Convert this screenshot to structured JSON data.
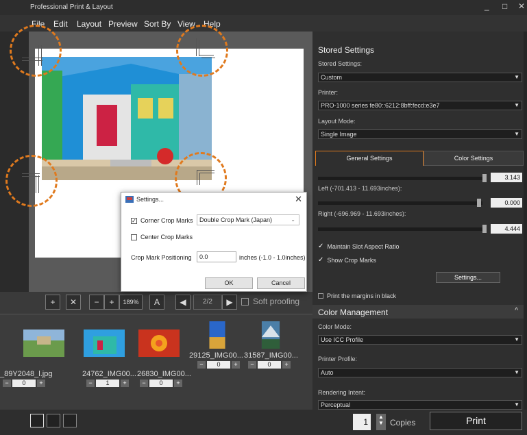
{
  "app": {
    "title": "Professional Print & Layout"
  },
  "menu": [
    "File",
    "Edit",
    "Layout",
    "Preview",
    "Sort By",
    "View",
    "Help"
  ],
  "toolbar": {
    "zoom": "189%",
    "page": "2/2",
    "soft_proofing": "Soft proofing"
  },
  "thumbnails": [
    {
      "name": "_89Y2048_l.jpg",
      "count": "0"
    },
    {
      "name": "24762_IMG00...",
      "count": "1"
    },
    {
      "name": "26830_IMG00...",
      "count": "0"
    },
    {
      "name": "29125_IMG00...",
      "count": "0"
    },
    {
      "name": "31587_IMG00...",
      "count": "0"
    }
  ],
  "bottom": {
    "copies_value": "1",
    "copies_label": "Copies",
    "print_label": "Print"
  },
  "right_panel": {
    "stored_settings_header": "Stored Settings",
    "stored_settings_label": "Stored Settings:",
    "stored_settings_value": "Custom",
    "printer_label": "Printer:",
    "printer_value": "PRO-1000 series fe80::6212:8bff:fecd:e3e7",
    "layout_mode_label": "Layout Mode:",
    "layout_mode_value": "Single Image",
    "tab_general": "General Settings",
    "tab_color": "Color Settings",
    "slider1_value": "3.143",
    "left_label": "Left (-701.413 - 11.693inches):",
    "slider2_value": "0.000",
    "right_label": "Right (-696.969 - 11.693inches):",
    "slider3_value": "4.444",
    "maintain_aspect": "Maintain Slot Aspect Ratio",
    "show_crop_marks": "Show Crop Marks",
    "settings_button": "Settings...",
    "print_margins_black": "Print the margins in black",
    "color_mgmt_header": "Color Management",
    "color_mode_label": "Color Mode:",
    "color_mode_value": "Use ICC Profile",
    "printer_profile_label": "Printer Profile:",
    "printer_profile_value": "Auto",
    "rendering_intent_label": "Rendering Intent:",
    "rendering_intent_value": "Perceptual"
  },
  "dialog": {
    "title": "Settings...",
    "corner_crop_marks": "Corner Crop Marks",
    "corner_crop_checked": true,
    "crop_style": "Double Crop Mark (Japan)",
    "center_crop_marks": "Center Crop Marks",
    "crop_positioning_label": "Crop Mark Positioning",
    "crop_positioning_value": "0.0",
    "units": "inches  (-1.0 - 1.0inches)",
    "ok": "OK",
    "cancel": "Cancel"
  },
  "colors": {
    "accent_orange": "#e07a1e",
    "panel_dark": "#2f2f2f",
    "tab_active_border": "#e07a1e"
  }
}
